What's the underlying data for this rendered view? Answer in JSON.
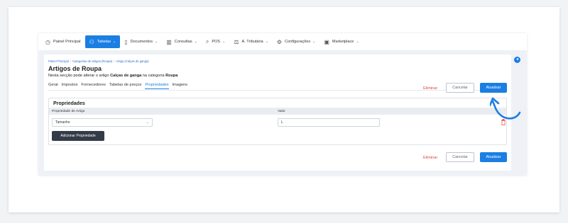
{
  "nav": {
    "items": [
      {
        "label": "Painel Principal",
        "icon": "dashboard-icon",
        "glyph": "◷",
        "chevron": false,
        "active": false
      },
      {
        "label": "Tabelas",
        "icon": "tables-icon",
        "glyph": "⚇",
        "chevron": true,
        "active": true
      },
      {
        "label": "Documentos",
        "icon": "document-icon",
        "glyph": "▯",
        "chevron": true,
        "active": false
      },
      {
        "label": "Consultas",
        "icon": "chart-icon",
        "glyph": "▥",
        "chevron": true,
        "active": false
      },
      {
        "label": "POS",
        "icon": "pos-icon",
        "glyph": "⌕",
        "chevron": true,
        "active": false
      },
      {
        "label": "A. Tributária",
        "icon": "tax-icon",
        "glyph": "⚖",
        "chevron": true,
        "active": false
      },
      {
        "label": "Configurações",
        "icon": "settings-icon",
        "glyph": "⚙",
        "chevron": true,
        "active": false
      },
      {
        "label": "Marketplace",
        "icon": "marketplace-icon",
        "glyph": "▣",
        "chevron": true,
        "active": false
      }
    ],
    "chevron_glyph": "⌄"
  },
  "breadcrumb": {
    "items": [
      "Painel Principal",
      "Categorias de artigos (Roupa)",
      "Artigo (Calças de ganga)"
    ],
    "separator": "/"
  },
  "page": {
    "title": "Artigos de Roupa",
    "subtitle_prefix": "Nesta secção pode alterar o artigo ",
    "subtitle_article": "Calças de ganga",
    "subtitle_middle": " na categoria ",
    "subtitle_category": "Roupa"
  },
  "tabs": [
    {
      "label": "Geral",
      "active": false
    },
    {
      "label": "Impostos",
      "active": false
    },
    {
      "label": "Fornecedores",
      "active": false
    },
    {
      "label": "Tabelas de preços",
      "active": false
    },
    {
      "label": "Propriedades",
      "active": true
    },
    {
      "label": "Imagens",
      "active": false
    }
  ],
  "actions": {
    "delete_label": "Eliminar",
    "cancel_label": "Cancelar",
    "update_label": "Atualizar"
  },
  "properties": {
    "title": "Propriedades",
    "columns": {
      "property": "Propriedade de Artigo",
      "value": "Valor"
    },
    "row": {
      "property": "Tamanho",
      "value": "L"
    },
    "add_label": "Adicionar Propriedade"
  },
  "colors": {
    "accent": "#1b7ee3",
    "danger": "#e0443e",
    "dark_button": "#343b48"
  },
  "icons": {
    "collapse": "◂",
    "select_arrow": "⌄"
  }
}
